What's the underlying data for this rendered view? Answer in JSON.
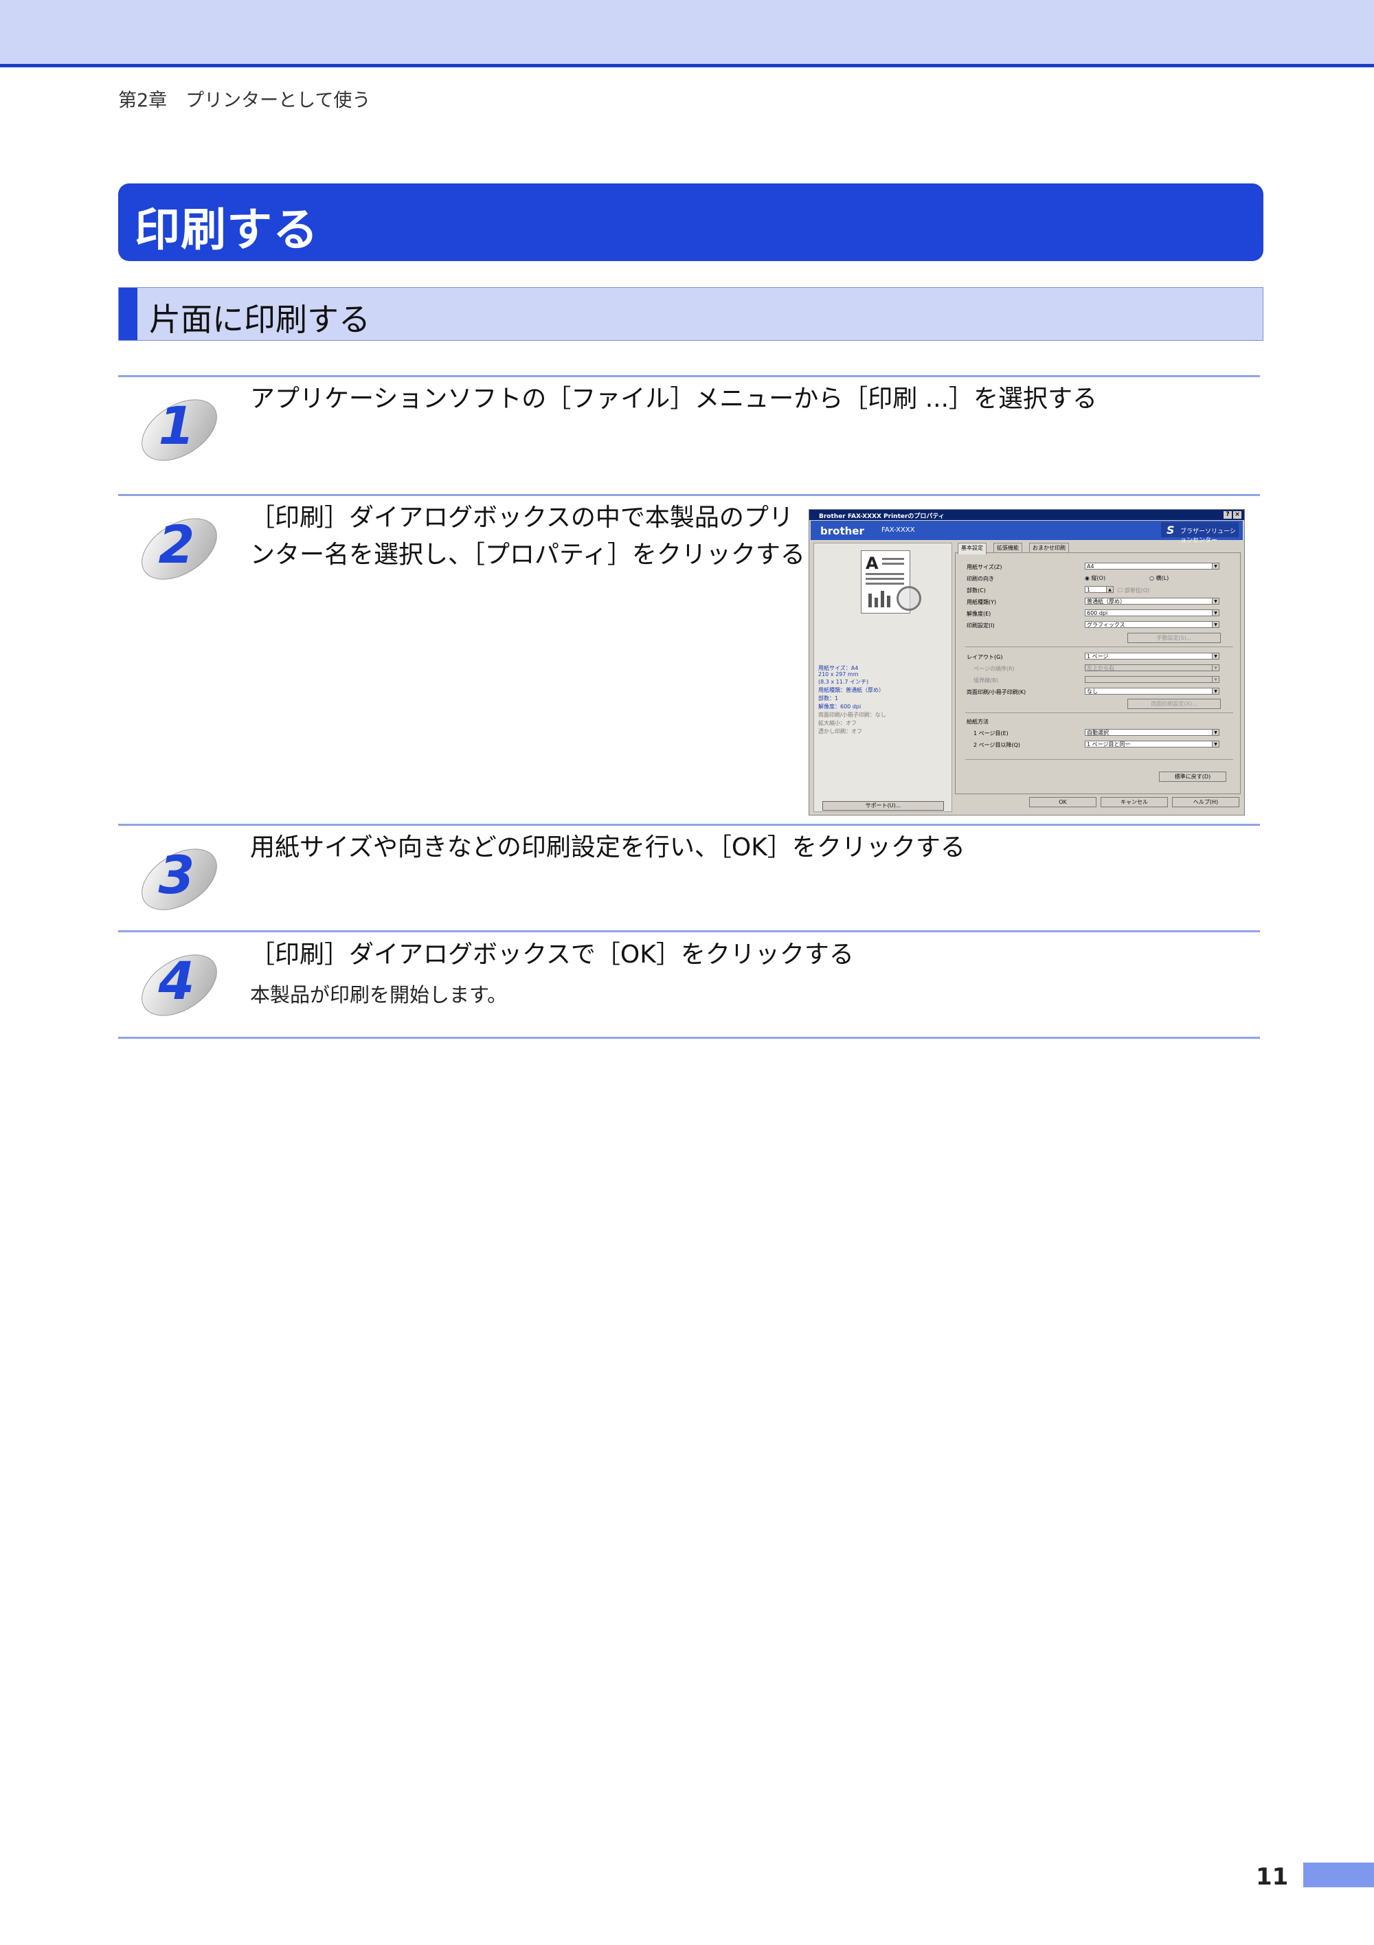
{
  "header": {
    "chapter": "第2章　プリンターとして使う"
  },
  "section": {
    "title": "印刷する",
    "subtitle": "片面に印刷する"
  },
  "steps": [
    {
      "num": "1",
      "text": "アプリケーションソフトの［ファイル］メニューから［印刷 ...］を選択する"
    },
    {
      "num": "2",
      "text_line1": "［印刷］ダイアログボックスの中で本製品のプリ",
      "text_line2": "ンター名を選択し、［プロパティ］をクリックする"
    },
    {
      "num": "3",
      "text": "用紙サイズや向きなどの印刷設定を行い、［OK］をクリックする"
    },
    {
      "num": "4",
      "text": "［印刷］ダイアログボックスで［OK］をクリックする",
      "sub": "本製品が印刷を開始します。"
    }
  ],
  "dialog": {
    "title": "Brother FAX-XXXX Printerのプロパティ",
    "help_btn": "?",
    "close_btn": "×",
    "logo": "brother",
    "model": "FAX-XXXX",
    "solutions": {
      "mark": "S",
      "label": "ブラザーソリューションセンター"
    },
    "tabs": [
      "基本設定",
      "拡張機能",
      "おまかせ印刷"
    ],
    "summary": [
      "用紙サイズ：A4",
      "210 x 297 mm",
      "(8.3 x 11.7 インチ)",
      "用紙種類：普通紙（厚め）",
      "部数：1",
      "解像度：600 dpi",
      "両面印刷/小冊子印刷：なし",
      "拡大縮小：オフ",
      "透かし印刷：オフ"
    ],
    "support_btn": "サポート(U)...",
    "fields": {
      "paper_size_label": "用紙サイズ(Z)",
      "paper_size_value": "A4",
      "orientation_label": "印刷の向き",
      "portrait": "縦(O)",
      "landscape": "横(L)",
      "copies_label": "部数(C)",
      "copies_value": "1",
      "collate": "部単位(O)",
      "media_label": "用紙種類(Y)",
      "media_value": "普通紙（厚め）",
      "resolution_label": "解像度(E)",
      "resolution_value": "600 dpi",
      "print_setting_label": "印刷設定(I)",
      "print_setting_value": "グラフィックス",
      "manual_btn": "手動設定(S)...",
      "layout_label": "レイアウト(G)",
      "layout_value": "1 ページ",
      "page_order_label": "ページの順序(R)",
      "page_order_value": "左上から右",
      "border_label": "境界線(B)",
      "border_value": "",
      "duplex_label": "両面印刷/小冊子印刷(K)",
      "duplex_value": "なし",
      "duplex_btn": "両面印刷設定(X)...",
      "feed_label": "給紙方法",
      "first_page_label": "1 ページ目(E)",
      "first_page_value": "自動選択",
      "other_pages_label": "2 ページ目以降(Q)",
      "other_pages_value": "1 ページ目と同一",
      "default_btn": "標準に戻す(D)"
    },
    "buttons": {
      "ok": "OK",
      "cancel": "キャンセル",
      "help": "ヘルプ(H)"
    }
  },
  "footer": {
    "page_number": "11"
  }
}
